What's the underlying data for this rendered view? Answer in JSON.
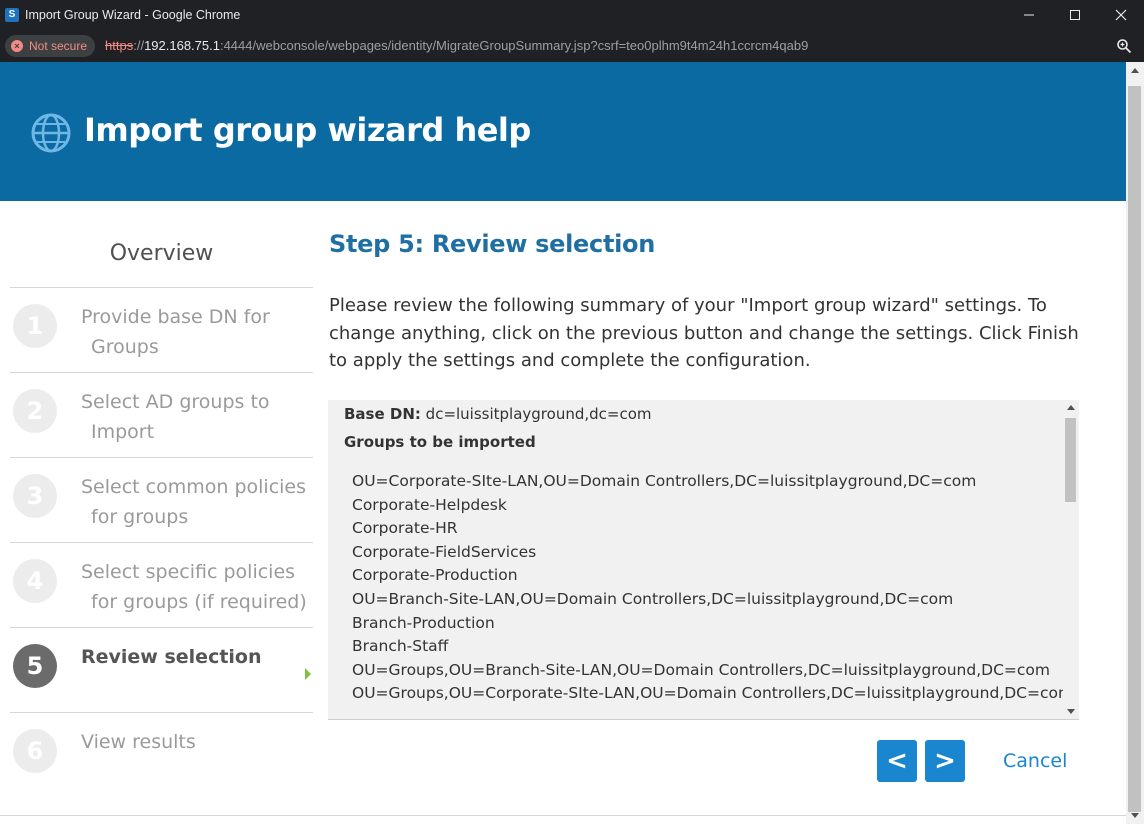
{
  "window": {
    "app_icon_letter": "S",
    "title": "Import Group Wizard - Google Chrome"
  },
  "address_bar": {
    "security_label": "Not secure",
    "url_scheme": "https",
    "url_sep": "://",
    "url_host": "192.168.75.1",
    "url_rest": ":4444/webconsole/webpages/identity/MigrateGroupSummary.jsp?csrf=teo0plhm9t4m24h1ccrcm4qab9"
  },
  "header": {
    "title": "Import group wizard help"
  },
  "sidebar": {
    "overview": "Overview",
    "steps": [
      {
        "num": "1",
        "line1": "Provide base DN for",
        "line2": "Groups"
      },
      {
        "num": "2",
        "line1": "Select AD groups to",
        "line2": "Import"
      },
      {
        "num": "3",
        "line1": "Select common policies",
        "line2": "for groups"
      },
      {
        "num": "4",
        "line1": "Select specific policies",
        "line2": "for groups (if required)"
      },
      {
        "num": "5",
        "line1": "Review selection",
        "line2": ""
      },
      {
        "num": "6",
        "line1": "View results",
        "line2": ""
      }
    ],
    "active_step": 5
  },
  "main": {
    "heading": "Step 5: Review selection",
    "intro": "Please review the following summary of your \"Import group wizard\" settings. To change anything, click on the previous button and change the settings. Click Finish to apply the settings and complete the configuration.",
    "summary": {
      "base_dn_label": "Base DN:",
      "base_dn_value": "dc=luissitplayground,dc=com",
      "groups_heading": "Groups to be imported",
      "groups": [
        "OU=Corporate-SIte-LAN,OU=Domain Controllers,DC=luissitplayground,DC=com",
        "Corporate-Helpdesk",
        "Corporate-HR",
        "Corporate-FieldServices",
        "Corporate-Production",
        "OU=Branch-Site-LAN,OU=Domain Controllers,DC=luissitplayground,DC=com",
        "Branch-Production",
        "Branch-Staff",
        "OU=Groups,OU=Branch-Site-LAN,OU=Domain Controllers,DC=luissitplayground,DC=com",
        "OU=Groups,OU=Corporate-SIte-LAN,OU=Domain Controllers,DC=luissitplayground,DC=com"
      ]
    },
    "buttons": {
      "prev": "<",
      "next": ">",
      "cancel": "Cancel"
    }
  },
  "colors": {
    "header_bg": "#0a6aa1",
    "heading_blue": "#1f6fa3",
    "button_blue": "#1a86d0",
    "active_marker": "#7cc242"
  }
}
